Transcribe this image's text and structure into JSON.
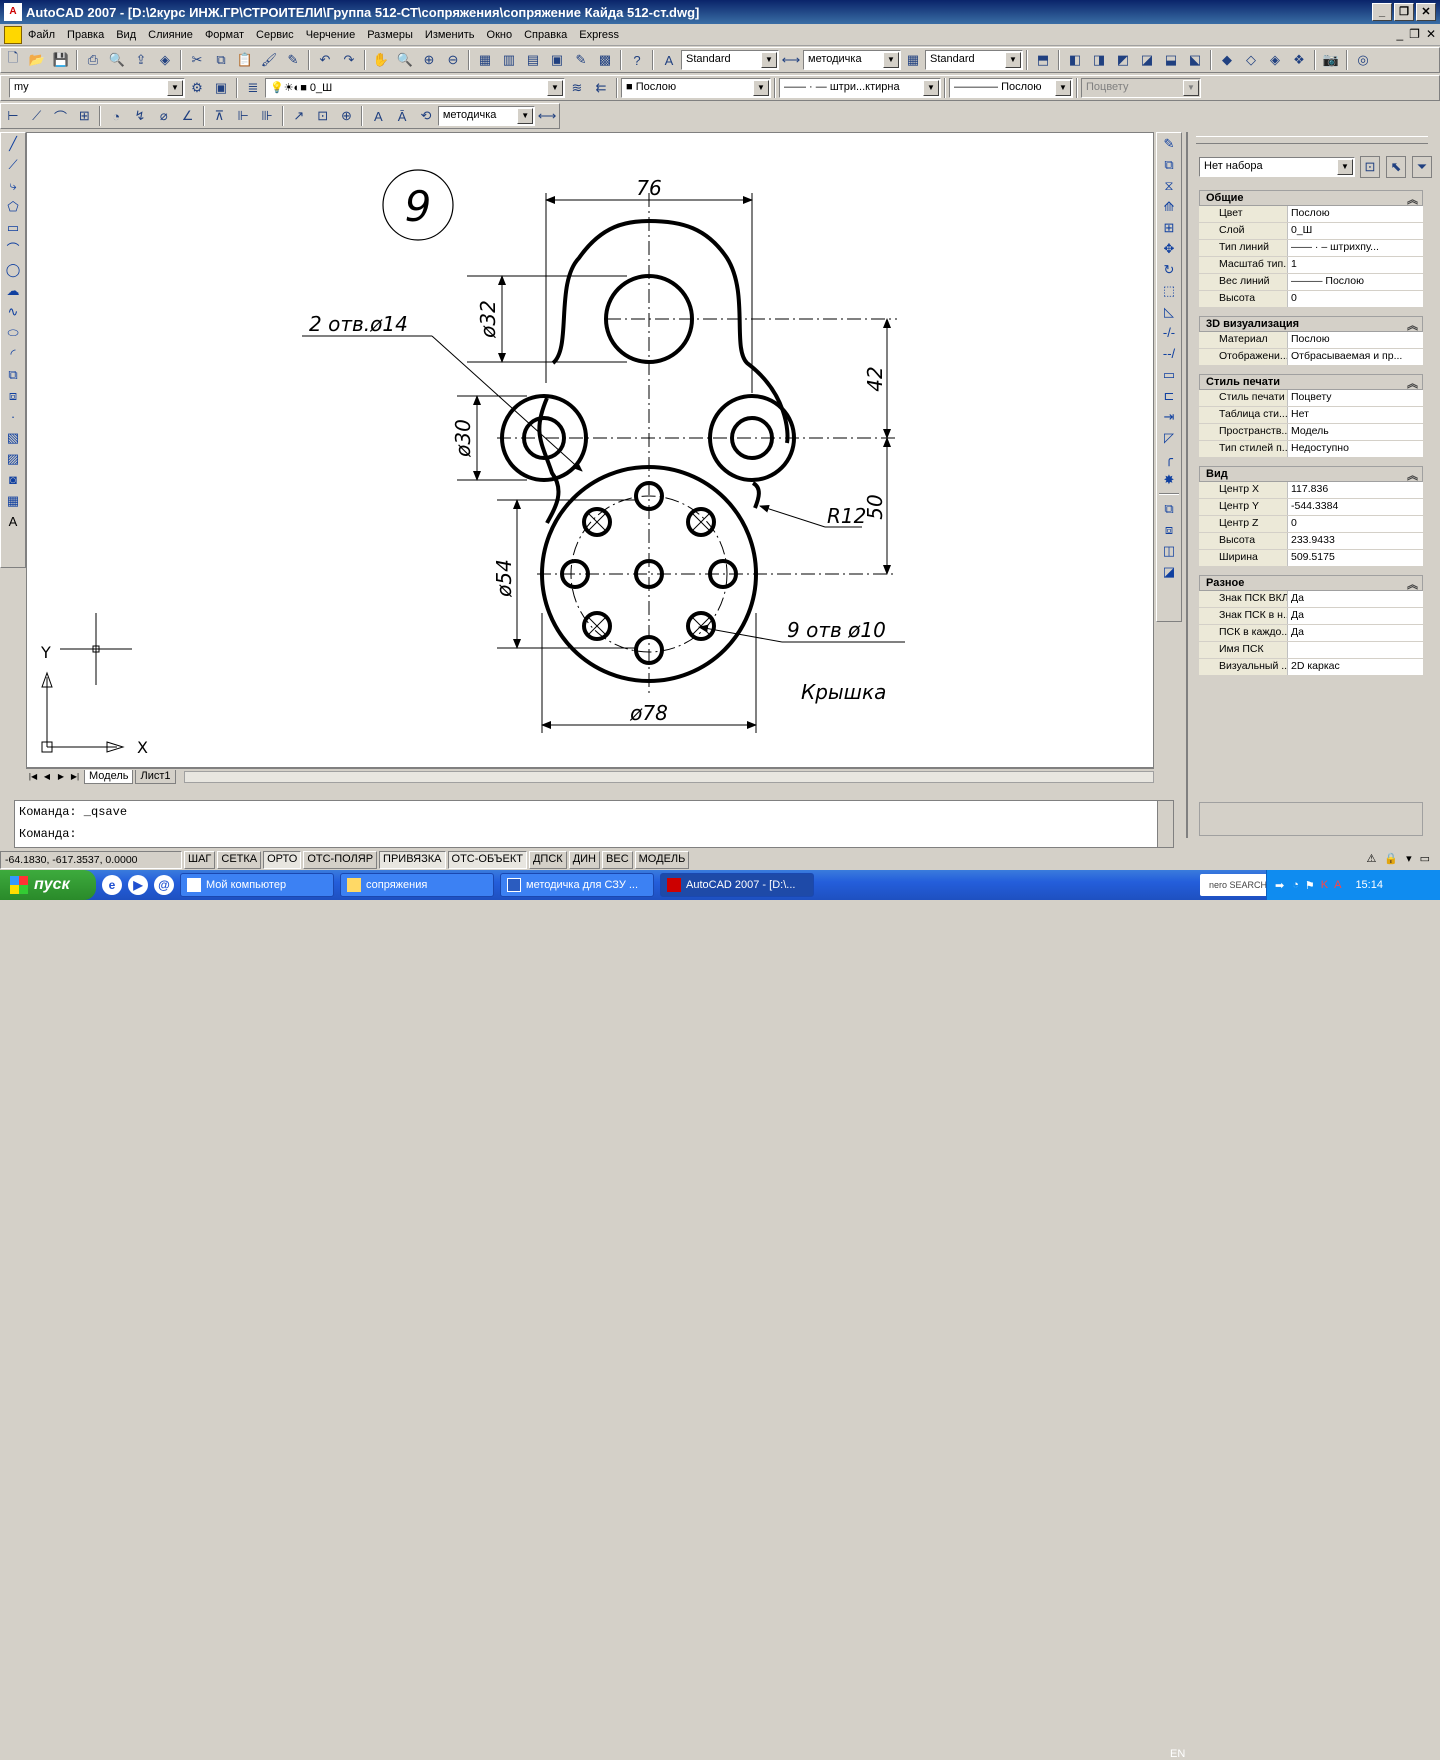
{
  "window": {
    "title": "AutoCAD 2007 - [D:\\2курс ИНЖ.ГР\\СТРОИТЕЛИ\\Группа 512-СТ\\сопряжения\\сопряжение Кайда 512-ст.dwg]",
    "app_icon": "A"
  },
  "menu": [
    "Файл",
    "Правка",
    "Вид",
    "Слияние",
    "Формат",
    "Сервис",
    "Черчение",
    "Размеры",
    "Изменить",
    "Окно",
    "Справка",
    "Express"
  ],
  "toolbars": {
    "text_style": "Standard",
    "dim_style": "методичка",
    "table_style": "Standard",
    "workspace": "my",
    "layer": "0_Ш",
    "color": "Послою",
    "linetype": "штри...ктирна",
    "lineweight": "Послою",
    "plotstyle": "Поцвету",
    "dim_style2": "методичка"
  },
  "drawing": {
    "number": "9",
    "dim_76": "76",
    "dim_32": "ø32",
    "dim_42": "42",
    "dim_30": "ø30",
    "dim_50": "50",
    "dim_54": "ø54",
    "dim_78": "ø78",
    "holes_2": "2 отв.ø14",
    "holes_9": "9  отв  ø10",
    "radius": "R12",
    "part_name": "Крышка",
    "ucs_x": "X",
    "ucs_y": "Y"
  },
  "layout_tabs": [
    "Модель",
    "Лист1"
  ],
  "properties": {
    "selection": "Нет набора",
    "sections": {
      "general": {
        "title": "Общие",
        "rows": [
          {
            "k": "Цвет",
            "v": "Послою"
          },
          {
            "k": "Слой",
            "v": "0_Ш"
          },
          {
            "k": "Тип линий",
            "v": "—— · – штрихпу..."
          },
          {
            "k": "Масштаб тип...",
            "v": "1"
          },
          {
            "k": "Вес линий",
            "v": "——— Послою"
          },
          {
            "k": "Высота",
            "v": "0"
          }
        ]
      },
      "viz3d": {
        "title": "3D визуализация",
        "rows": [
          {
            "k": "Материал",
            "v": "Послою"
          },
          {
            "k": "Отображени...",
            "v": "Отбрасываемая и пр..."
          }
        ]
      },
      "plot": {
        "title": "Стиль печати",
        "rows": [
          {
            "k": "Стиль печати",
            "v": "Поцвету"
          },
          {
            "k": "Таблица сти...",
            "v": "Нет"
          },
          {
            "k": "Пространств...",
            "v": "Модель"
          },
          {
            "k": "Тип стилей п...",
            "v": "Недоступно"
          }
        ]
      },
      "view": {
        "title": "Вид",
        "rows": [
          {
            "k": "Центр X",
            "v": "117.836"
          },
          {
            "k": "Центр Y",
            "v": "-544.3384"
          },
          {
            "k": "Центр Z",
            "v": "0"
          },
          {
            "k": "Высота",
            "v": "233.9433"
          },
          {
            "k": "Ширина",
            "v": "509.5175"
          }
        ]
      },
      "misc": {
        "title": "Разное",
        "rows": [
          {
            "k": "Знак ПСК ВКЛ",
            "v": "Да"
          },
          {
            "k": "Знак ПСК в н...",
            "v": "Да"
          },
          {
            "k": "ПСК в каждо...",
            "v": "Да"
          },
          {
            "k": "Имя ПСК",
            "v": ""
          },
          {
            "k": "Визуальный ...",
            "v": "2D каркас"
          }
        ]
      }
    }
  },
  "command": {
    "line1": "Команда:  _qsave",
    "line2": "Команда:"
  },
  "status": {
    "coords": "-64.1830, -617.3537, 0.0000",
    "buttons": [
      "ШАГ",
      "СЕТКА",
      "ОРТО",
      "ОТС-ПОЛЯР",
      "ПРИВЯЗКА",
      "ОТС-ОБЪЕКТ",
      "ДПСК",
      "ДИН",
      "ВЕС",
      "МОДЕЛЬ"
    ]
  },
  "taskbar": {
    "start": "пуск",
    "tasks": [
      "Мой компьютер",
      "сопряжения",
      "методичка для СЗУ ...",
      "AutoCAD 2007 - [D:\\..."
    ],
    "lang": "EN",
    "clock": "15:14",
    "nero": "nero SEARCH"
  },
  "colors": {
    "title_bg": "#0a246a",
    "taskbar": "#245edb",
    "start": "#3dab3d"
  }
}
